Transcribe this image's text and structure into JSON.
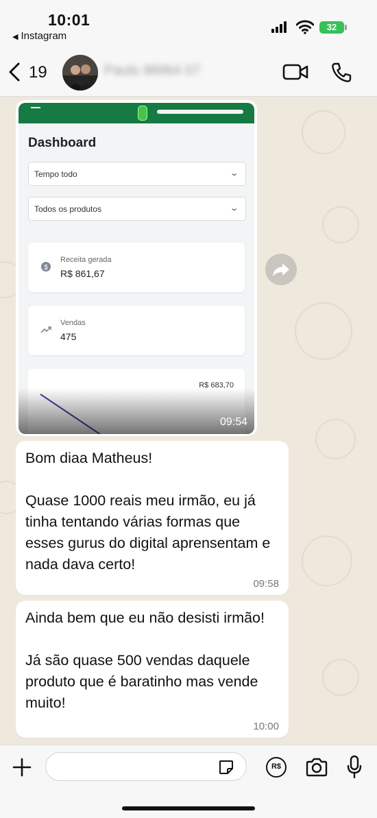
{
  "status_bar": {
    "time": "10:01",
    "back_app": "Instagram",
    "battery": "32"
  },
  "header": {
    "unread_count": "19",
    "contact_name": "Paulo 98964 07"
  },
  "messages": {
    "image": {
      "time": "09:54",
      "dashboard": {
        "title": "Dashboard",
        "filter_period": "Tempo todo",
        "filter_product": "Todos os produtos",
        "revenue_label": "Receita gerada",
        "revenue_value": "R$ 861,67",
        "sales_label": "Vendas",
        "sales_value": "475",
        "chart_peak": "R$ 683,70"
      }
    },
    "msg1": {
      "text": "Bom diaa Matheus!\n\nQuase 1000 reais meu irmão, eu já tinha tentando várias formas que esses gurus do digital aprensentam e nada dava certo!",
      "time": "09:58"
    },
    "msg2": {
      "text": "Ainda bem que eu não desisti irmão!\n\nJá são quase 500 vendas daquele produto que é baratinho mas vende muito!",
      "time": "10:00"
    }
  },
  "composer": {
    "input_value": "",
    "pay_label": "R$"
  },
  "colors": {
    "dashboard_green": "#167a43",
    "chat_background": "#efe8dc",
    "battery_green": "#36c15a"
  }
}
